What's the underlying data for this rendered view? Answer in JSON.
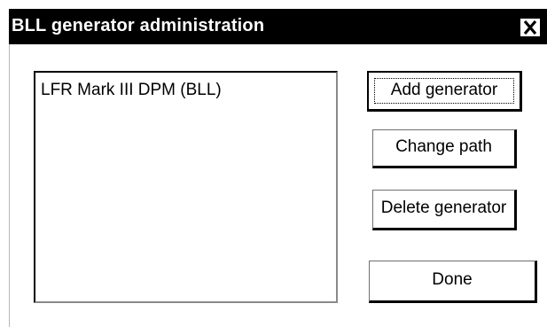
{
  "window": {
    "title": "BLL generator administration",
    "close_icon": "close-icon"
  },
  "generator_list": {
    "items": [
      "LFR Mark III DPM (BLL)"
    ]
  },
  "buttons": {
    "add_label": "Add generator",
    "change_path_label": "Change path",
    "delete_label": "Delete generator",
    "done_label": "Done"
  }
}
